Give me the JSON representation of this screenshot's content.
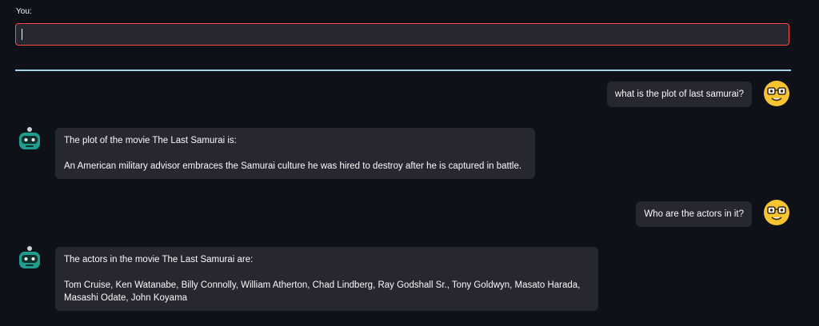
{
  "input": {
    "label": "You:",
    "value": ""
  },
  "messages": [
    {
      "role": "user",
      "text": "what is the plot of last samurai?"
    },
    {
      "role": "bot",
      "paragraphs": [
        "The plot of the movie The Last Samurai is:",
        "An American military advisor embraces the Samurai culture he was hired to destroy after he is captured in battle."
      ]
    },
    {
      "role": "user",
      "text": "Who are the actors in it?"
    },
    {
      "role": "bot",
      "paragraphs": [
        "The actors in the movie The Last Samurai are:",
        "Tom Cruise, Ken Watanabe, Billy Connolly, William Atherton, Chad Lindberg, Ray Godshall Sr., Tony Goldwyn, Masato Harada, Masashi Odate, John Koyama"
      ]
    }
  ],
  "icons": {
    "user_avatar": "nerd-face-emoji-icon",
    "bot_avatar": "robot-icon"
  },
  "colors": {
    "background": "#0e1117",
    "bubble": "#262730",
    "input_border_focus": "#ff4b4b",
    "divider": "#9fd3ee",
    "user_avatar": "#f7c531",
    "bot_avatar": "#1f9e8f"
  }
}
